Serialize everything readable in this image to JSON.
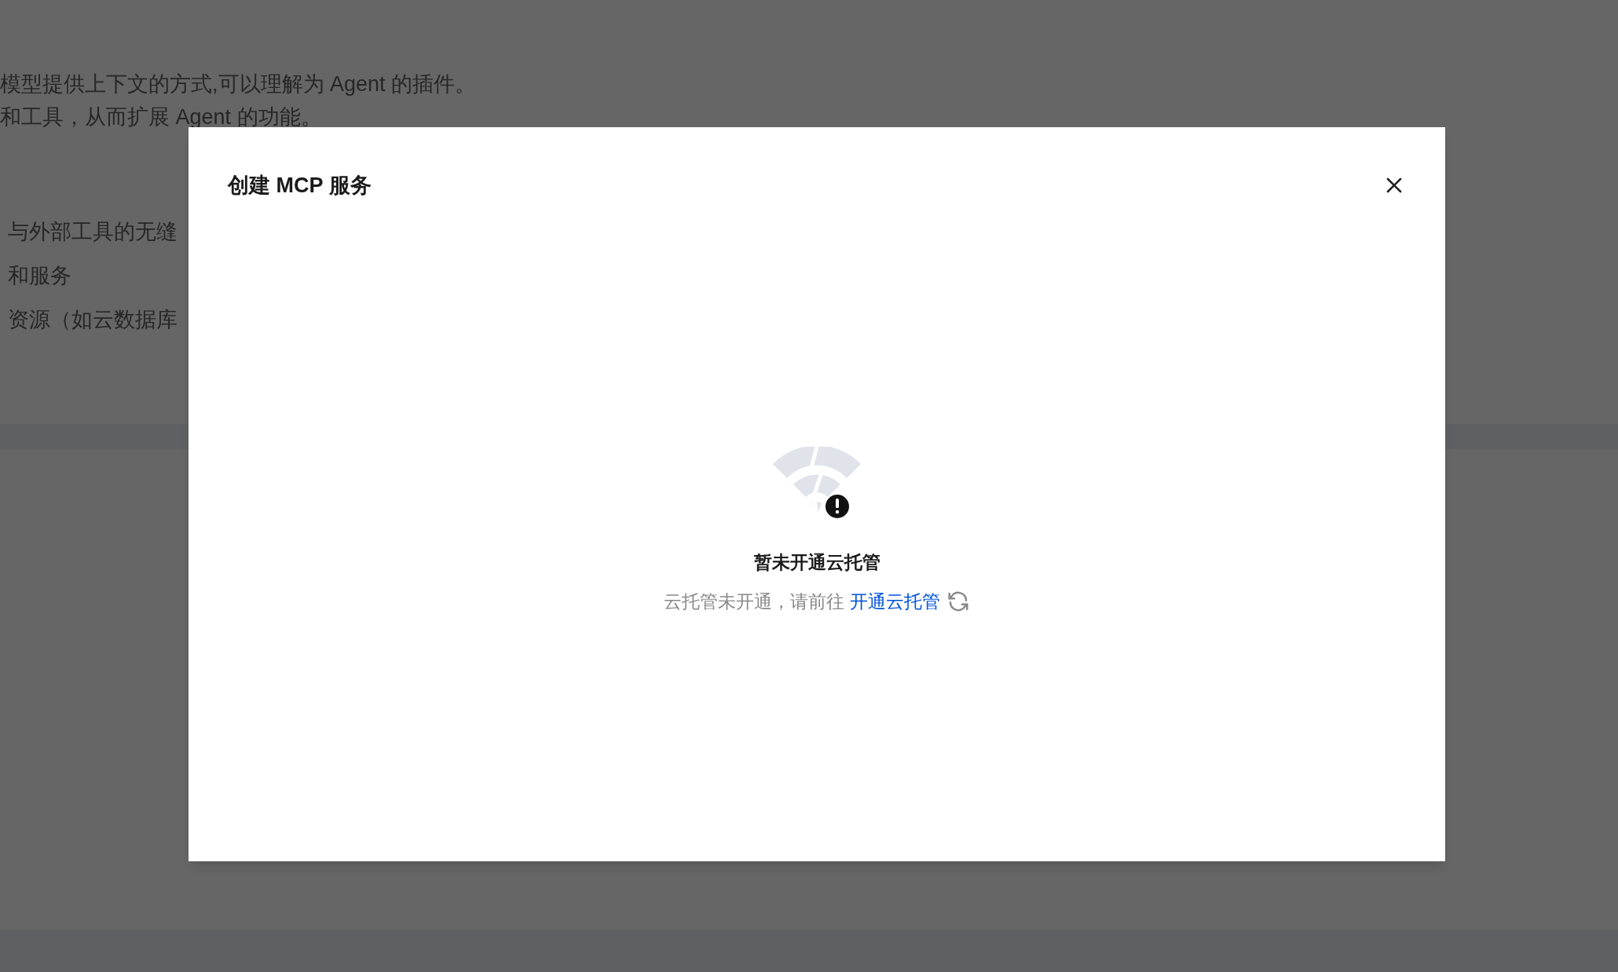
{
  "background_page": {
    "intro_lines": [
      "模型提供上下文的方式,可以理解为 Agent 的插件。",
      "和工具，从而扩展 Agent 的功能。"
    ],
    "list_lines": [
      "与外部工具的无缝",
      "和服务",
      "资源（如云数据库"
    ]
  },
  "dialog": {
    "title": "创建 MCP 服务",
    "empty_state": {
      "title": "暂未开通云托管",
      "message": "云托管未开通，请前往",
      "link": "开通云托管"
    }
  }
}
